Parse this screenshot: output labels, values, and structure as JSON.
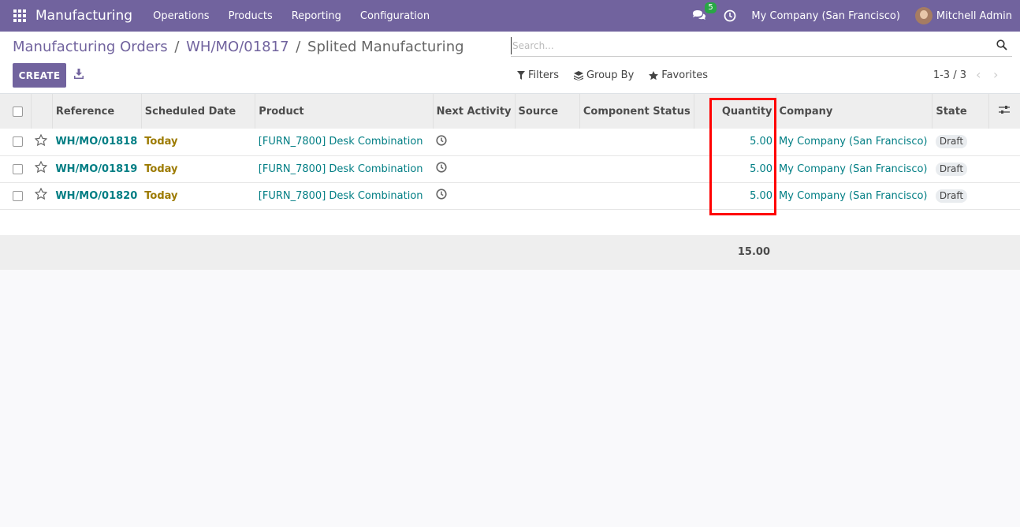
{
  "navbar": {
    "app_name": "Manufacturing",
    "menu": [
      "Operations",
      "Products",
      "Reporting",
      "Configuration"
    ],
    "chat_count": "5",
    "company": "My Company (San Francisco)",
    "user": "Mitchell Admin",
    "accent_color": "#71639e"
  },
  "breadcrumb": {
    "items": [
      "Manufacturing Orders",
      "WH/MO/01817"
    ],
    "current": "Splited Manufacturing"
  },
  "control": {
    "create_label": "CREATE",
    "search_placeholder": "Search...",
    "filters_label": "Filters",
    "groupby_label": "Group By",
    "favorites_label": "Favorites",
    "pager": "1-3 / 3"
  },
  "table": {
    "columns": [
      "Reference",
      "Scheduled Date",
      "Product",
      "Next Activity",
      "Source",
      "Component Status",
      "Quantity",
      "Company",
      "State"
    ],
    "rows": [
      {
        "reference": "WH/MO/01818",
        "date": "Today",
        "product": "[FURN_7800] Desk Combination",
        "source": "",
        "component_status": "",
        "quantity": "5.00",
        "company": "My Company (San Francisco)",
        "state": "Draft"
      },
      {
        "reference": "WH/MO/01819",
        "date": "Today",
        "product": "[FURN_7800] Desk Combination",
        "source": "",
        "component_status": "",
        "quantity": "5.00",
        "company": "My Company (San Francisco)",
        "state": "Draft"
      },
      {
        "reference": "WH/MO/01820",
        "date": "Today",
        "product": "[FURN_7800] Desk Combination",
        "source": "",
        "component_status": "",
        "quantity": "5.00",
        "company": "My Company (San Francisco)",
        "state": "Draft"
      }
    ],
    "total_quantity": "15.00"
  },
  "highlight_color": "#ff0000"
}
